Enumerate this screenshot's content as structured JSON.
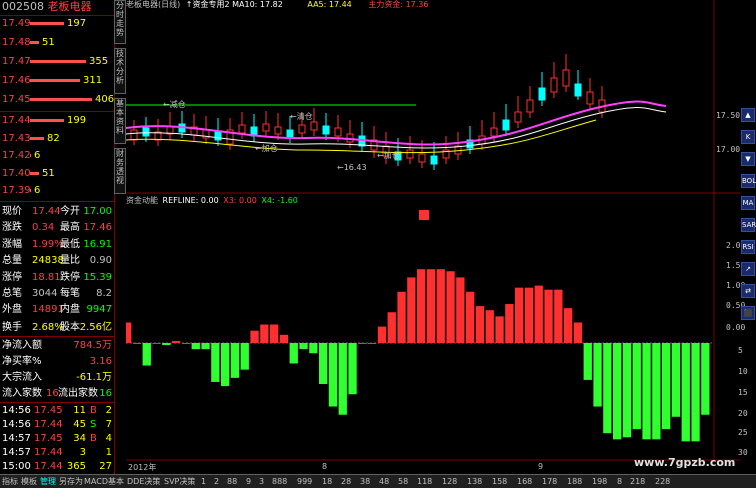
{
  "stock": {
    "code": "002508",
    "name": "老板电器"
  },
  "sell_orders": [
    {
      "price": "17.49",
      "vol": "197",
      "bar": 0.55
    },
    {
      "price": "17.48",
      "vol": "51",
      "bar": 0.14
    },
    {
      "price": "17.47",
      "vol": "355",
      "bar": 0.9
    },
    {
      "price": "17.46",
      "vol": "311",
      "bar": 0.8
    },
    {
      "price": "17.45",
      "vol": "406",
      "bar": 1.0
    }
  ],
  "buy_orders": [
    {
      "price": "17.44",
      "vol": "199",
      "bar": 0.55
    },
    {
      "price": "17.43",
      "vol": "82",
      "bar": 0.22
    },
    {
      "price": "17.42",
      "vol": "6",
      "bar": 0.02
    },
    {
      "price": "17.40",
      "vol": "51",
      "bar": 0.14
    },
    {
      "price": "17.39",
      "vol": "6",
      "bar": 0.02
    }
  ],
  "quote": [
    {
      "l1": "现价",
      "v1": "17.44",
      "l2": "今开",
      "v2": "17.00",
      "c1": "#ff4040",
      "c2": "#00ff00"
    },
    {
      "l1": "涨跌",
      "v1": "0.34",
      "l2": "最高",
      "v2": "17.46",
      "c1": "#ff4040",
      "c2": "#ff4040"
    },
    {
      "l1": "涨幅",
      "v1": "1.99%",
      "l2": "最低",
      "v2": "16.91",
      "c1": "#ff4040",
      "c2": "#00ff00"
    },
    {
      "l1": "总量",
      "v1": "24838",
      "l2": "量比",
      "v2": "0.90",
      "c1": "#ffff00",
      "c2": "#c0c0c0"
    },
    {
      "l1": "涨停",
      "v1": "18.81",
      "l2": "跌停",
      "v2": "15.39",
      "c1": "#ff4040",
      "c2": "#00ff00"
    },
    {
      "l1": "总笔",
      "v1": "3044",
      "l2": "每笔",
      "v2": "8.2",
      "c1": "#c0c0c0",
      "c2": "#c0c0c0"
    },
    {
      "l1": "外盘",
      "v1": "14891",
      "l2": "内盘",
      "v2": "9947",
      "c1": "#ff4040",
      "c2": "#00ff00"
    }
  ],
  "turnover": {
    "l1": "换手",
    "v1": "2.68%",
    "l2": "股本",
    "v2": "2.56亿"
  },
  "flows": [
    {
      "label": "净流入额",
      "value": "784.5万",
      "color": "#ff4040"
    },
    {
      "label": "净买率%",
      "value": "3.16",
      "color": "#ff4040"
    },
    {
      "label": "大宗流入",
      "value": "-61.1万",
      "color": "#ffff00"
    }
  ],
  "counts": {
    "in_label": "流入家数",
    "in_value": "16",
    "out_label": "流出家数",
    "out_value": "16"
  },
  "ticks": [
    {
      "time": "14:56",
      "price": "17.45",
      "vol": "11",
      "bs": "B",
      "n": "2",
      "bsc": "#ff4040"
    },
    {
      "time": "14:56",
      "price": "17.44",
      "vol": "45",
      "bs": "S",
      "n": "7",
      "bsc": "#00ff00"
    },
    {
      "time": "14:57",
      "price": "17.45",
      "vol": "34",
      "bs": "B",
      "n": "4",
      "bsc": "#ff4040"
    },
    {
      "time": "14:57",
      "price": "17.44",
      "vol": "3",
      "bs": "",
      "n": "1",
      "bsc": "#c0c0c0"
    },
    {
      "time": "15:00",
      "price": "17.44",
      "vol": "365",
      "bs": "",
      "n": "27",
      "bsc": "#c0c0c0"
    }
  ],
  "vtabs": [
    "分时走势",
    "技术分析",
    "基本资料",
    "财务透视"
  ],
  "main_chart": {
    "header": [
      {
        "text": "老板电器(日线)",
        "color": "#c0c0c0"
      },
      {
        "text": "↑资金专用2 MA10: 17.82",
        "color": "#ffffff"
      },
      {
        "text": "AA5: 17.44",
        "color": "#ffff00"
      },
      {
        "text": "主力资金: 17.36",
        "color": "#ff4040"
      }
    ],
    "price_ticks": [
      "17.00",
      "17.50"
    ],
    "annotations": [
      {
        "text": "←减仓",
        "color": "#00ff00"
      },
      {
        "text": "←清仓",
        "color": "#00ff00"
      },
      {
        "text": "←加仓",
        "color": "#ff4040"
      },
      {
        "text": "←加仓",
        "color": "#ff4040"
      },
      {
        "text": "←16.43",
        "color": "#c0c0c0"
      }
    ]
  },
  "indicator": {
    "title": "资金动能",
    "params": [
      {
        "text": "REFLINE: 0.00",
        "color": "#ffffff"
      },
      {
        "text": "X3: 0.00",
        "color": "#ff4040"
      },
      {
        "text": "X4: -1.60",
        "color": "#00ff00"
      }
    ],
    "y_ticks": [
      "2.00",
      "1.50",
      "1.00",
      "0.50",
      "0.00",
      "5",
      "10",
      "15",
      "20",
      "25",
      "30"
    ]
  },
  "chart_data": {
    "type": "bar",
    "title": "资金动能",
    "values": [
      1.0,
      0,
      -1.1,
      0,
      -0.1,
      0.1,
      0,
      -0.3,
      -0.3,
      -1.9,
      -2.1,
      -1.7,
      -1.3,
      0.6,
      0.9,
      0.9,
      0.4,
      -1.0,
      -0.3,
      -0.5,
      -2.0,
      -3.1,
      -3.5,
      -2.5,
      0,
      0.0,
      0.8,
      1.5,
      2.5,
      3.2,
      3.6,
      3.6,
      3.6,
      3.5,
      3.2,
      2.5,
      1.8,
      1.6,
      1.3,
      1.9,
      2.7,
      2.7,
      2.8,
      2.6,
      2.6,
      1.7,
      1.0,
      -1.8,
      -3.1,
      -4.4,
      -4.7,
      -4.6,
      -4.2,
      -4.7,
      -4.7,
      -4.2,
      -3.6,
      -4.8,
      -4.8,
      -3.5
    ]
  },
  "time_axis": {
    "labels": [
      "2012年",
      "8",
      "9"
    ]
  },
  "bottom_tabs": [
    "指标",
    "模板",
    "管理",
    "另存为",
    "MACD基本",
    "DDE决策",
    "SVP决策",
    "1",
    "2",
    "88",
    "9",
    "3",
    "888",
    "999",
    "18",
    "28",
    "38",
    "48",
    "58",
    "118",
    "128",
    "138",
    "158",
    "168",
    "178",
    "188",
    "198",
    "8",
    "218",
    "228"
  ],
  "right_tools": [
    "▲",
    "K",
    "▼",
    "BOLL",
    "MA",
    "SAR",
    "RSI",
    "↗",
    "⇄",
    "⬛"
  ],
  "watermark": "www.7gpzb.com",
  "colors": {
    "up": "#ff3030",
    "down": "#30ff30",
    "grid": "#800000",
    "text": "#c0c0c0"
  }
}
